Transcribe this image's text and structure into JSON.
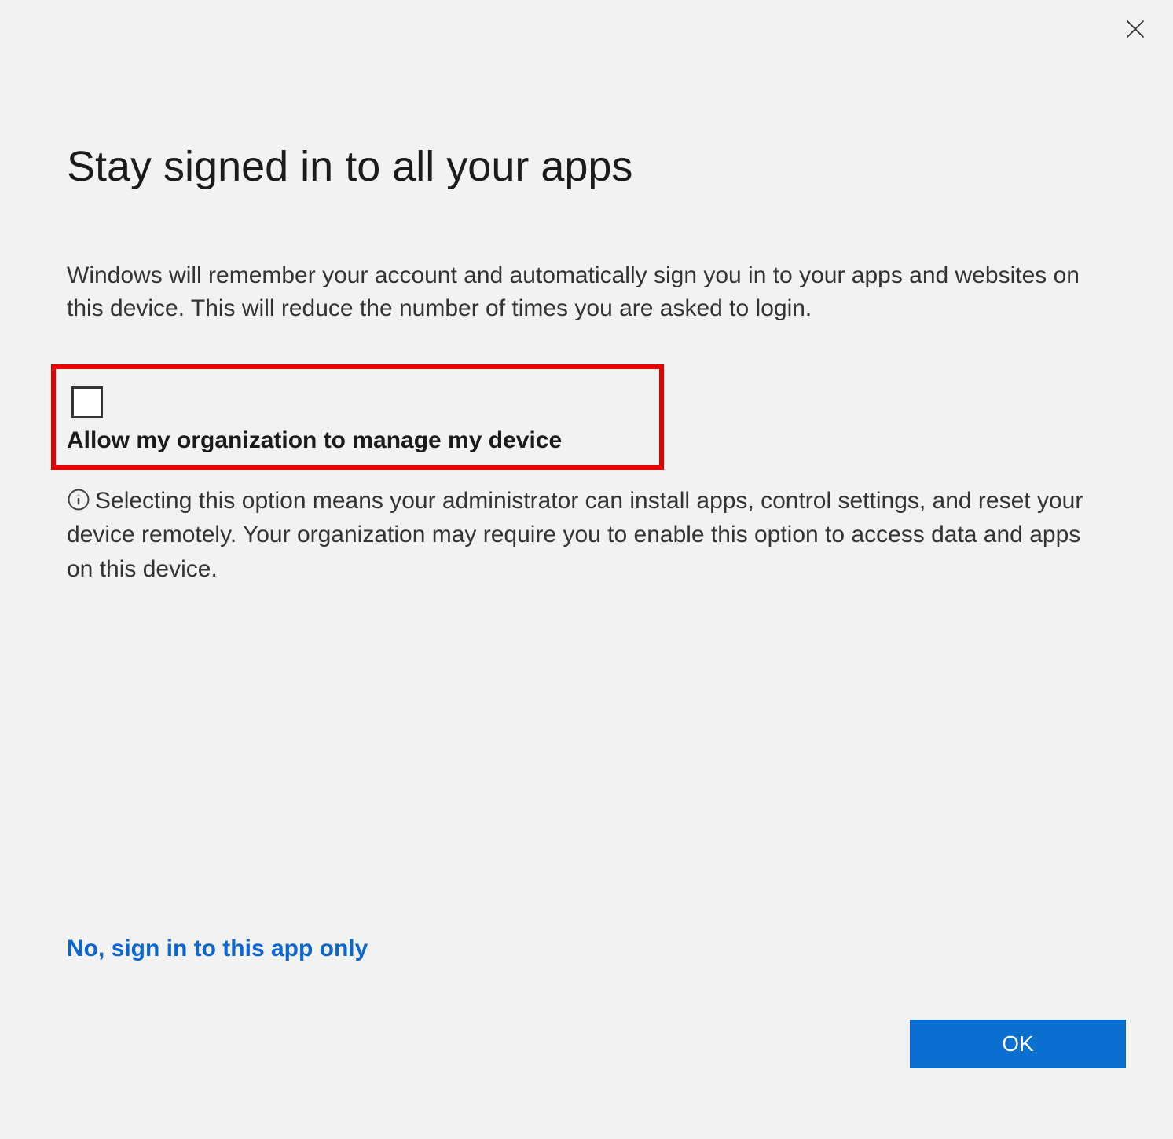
{
  "dialog": {
    "title": "Stay signed in to all your apps",
    "description": "Windows will remember your account and automatically sign you in to your apps and websites on this device. This will reduce the number of times you are asked to login.",
    "checkbox_label": "Allow my organization to manage my device",
    "info_text": "Selecting this option means your administrator can install apps, control settings, and reset your device remotely. Your organization may require you to enable this option to access data and apps on this device.",
    "link_text": "No, sign in to this app only",
    "ok_button": "OK"
  }
}
